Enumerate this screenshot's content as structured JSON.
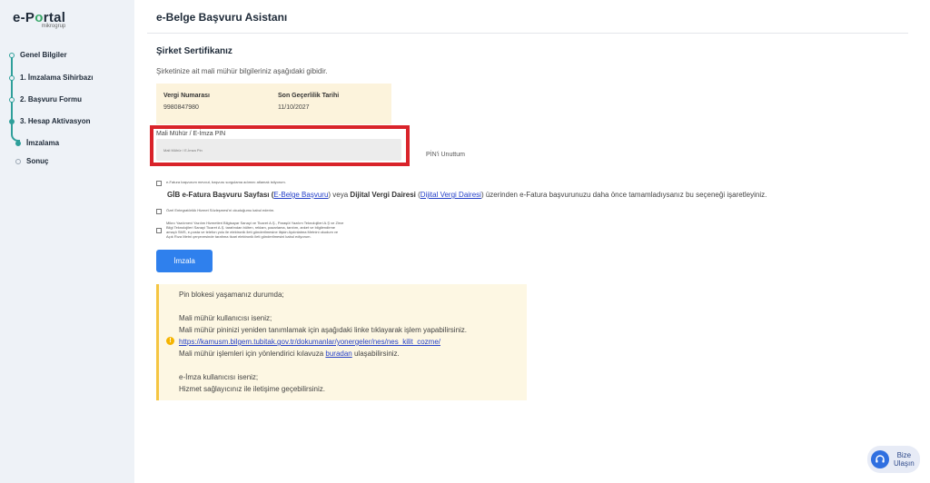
{
  "brand": {
    "name_prefix": "e-P",
    "name_o": "o",
    "name_suffix": "rtal",
    "sub": "mikrogrup"
  },
  "sidebar": {
    "steps": [
      {
        "label": "Genel Bilgiler"
      },
      {
        "label": "1. İmzalama Sihirbazı"
      },
      {
        "label": "2. Başvuru Formu"
      },
      {
        "label": "3. Hesap Aktivasyon"
      },
      {
        "label": "İmzalama"
      },
      {
        "label": "Sonuç"
      }
    ]
  },
  "page": {
    "title": "e-Belge Başvuru Asistanı",
    "section_title": "Şirket Sertifikanız",
    "section_desc": "Şirketinize ait mali mühür bilgileriniz aşağıdaki gibidir."
  },
  "certificate": {
    "tax_no_label": "Vergi Numarası",
    "tax_no_value": "9980847980",
    "expiry_label": "Son Geçerlilik Tarihi",
    "expiry_value": "11/10/2027"
  },
  "pin": {
    "label": "Mali Mühür / E-İmza PIN",
    "placeholder": "Mali Mühür / E-İmza Pin",
    "forgot_label": "PİN'i Unuttum"
  },
  "checks": {
    "efatura_existing": "e-Fatura başvurum mevcut, başvuru sorgulama adımını atlamak istiyorum.",
    "gib_prefix": "GİB e-Fatura Başvuru Sayfası (",
    "gib_link": "E-Belge Başvuru",
    "gib_mid1": ") veya ",
    "gib_bold": "Dijital Vergi Dairesi",
    "gib_mid2": " (",
    "dvd_link": "Dijital Vergi Dairesi",
    "gib_suffix": ") üzerinden e-Fatura başvurunuzu daha önce tamamladıysanız bu seçeneği işaretleyiniz.",
    "integrator_contract": "Özel Entegratörlük Hizmet Sözleşmesi'ni okuduğumu kabul ederim.",
    "consent_line1": "Mikro Yazılımevi Yazılım Hizmetleri Bilgisayar Sanayi ve Ticaret A.Ş., Paraşüt Yazılım Teknolojileri A.Ş ve Zirve",
    "consent_line2": "Bilgi Teknolojileri Sanayi Ticaret A.Ş. tarafından bülten, reklam, pazarlama, tanıtım, anket ve bilgilendirme",
    "consent_line3": "amaçlı SMS, e-posta ve telefon yolu ile elektronik ileti gönderilmesine ilişkin Aydınlatma Metnini okudum ve",
    "consent_line4": "Açık Rıza Metni çerçevesinde tarafıma ticari elektronik ileti gönderilmesini kabul ediyorum."
  },
  "sign_button": "İmzala",
  "info": {
    "line1": "Pin blokesi yaşamanız durumda;",
    "line2": "Mali mühür kullanıcısı iseniz;",
    "line3": "Mali mühür pininizi yeniden tanımlamak için aşağıdaki linke tıklayarak işlem yapabilirsiniz.",
    "link": "https://kamusm.bilgem.tubitak.gov.tr/dokumanlar/yonergeler/nes/nes_kilit_cozme/",
    "line5_prefix": "Mali mühür işlemleri için yönlendirici kılavuza ",
    "line5_link": "buradan",
    "line5_suffix": " ulaşabilirsiniz.",
    "line6": "e-İmza kullanıcısı iseniz;",
    "line7": "Hizmet sağlayıcınız ile iletişime geçebilirsiniz."
  },
  "contact": {
    "line1": "Bize",
    "line2": "Ulaşın"
  }
}
